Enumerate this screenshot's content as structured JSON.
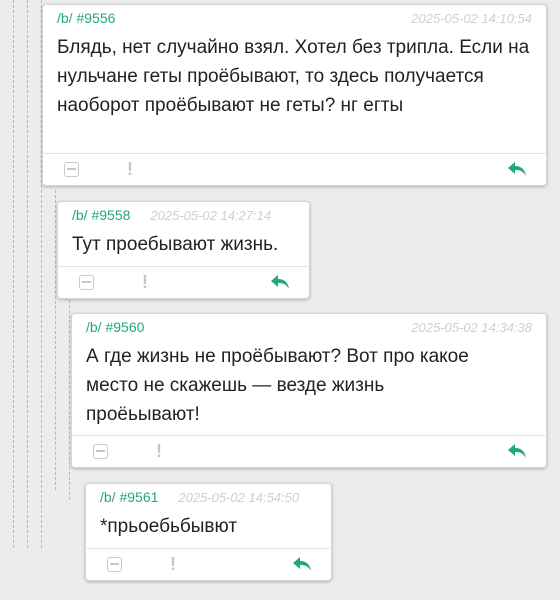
{
  "colors": {
    "accent": "#23a783",
    "background": "#ececec",
    "card": "#ffffff",
    "date": "#cfcfcf",
    "text": "#222222"
  },
  "icons": {
    "hide": "minus-square-icon",
    "report": "exclamation-icon",
    "reply": "reply-arrow-icon"
  },
  "posts": [
    {
      "board_id": "/b/ #9556",
      "date": "2025-05-02 14:10:54",
      "text": "Блядь, нет случайно взял. Хотел без трипла. Если на нульчане геты проёбывают, то здесь получается наоборот проёбывают не геты? нг егты"
    },
    {
      "board_id": "/b/ #9558",
      "date": "2025-05-02 14:27:14",
      "text": "Тут проебывают жизнь."
    },
    {
      "board_id": "/b/ #9560",
      "date": "2025-05-02 14:34:38",
      "text": "А где жизнь не проёбывают? Вот про какое место не скажешь — везде жизнь проёьывают!"
    },
    {
      "board_id": "/b/ #9561",
      "date": "2025-05-02 14:54:50",
      "text": "*прьоебьбывют"
    }
  ]
}
